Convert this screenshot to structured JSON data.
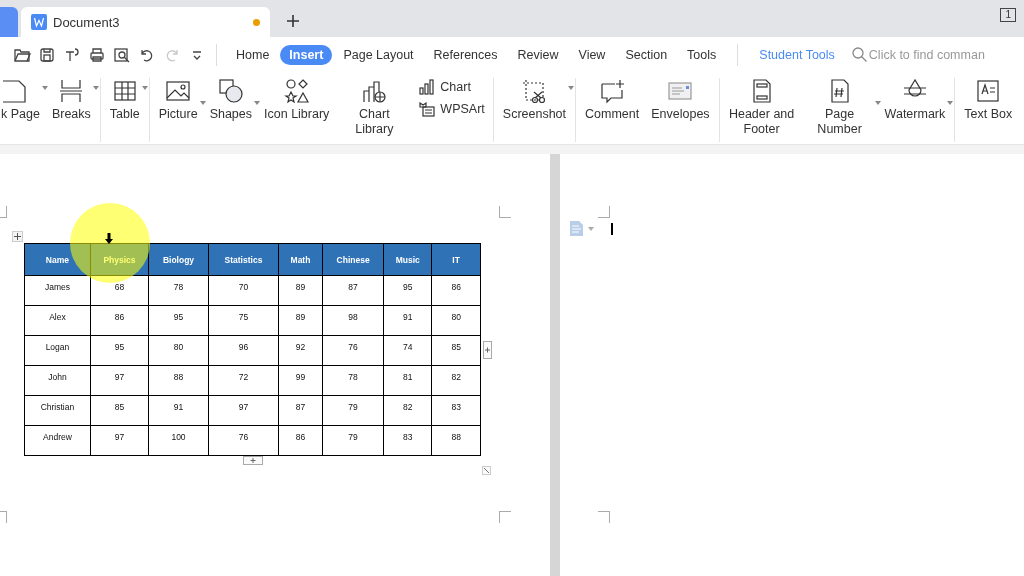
{
  "tab_bar": {
    "document": {
      "title": "Document3",
      "modified": true
    },
    "window_count": "1"
  },
  "quick_access": [
    {
      "disabled": false
    },
    {
      "disabled": false
    },
    {
      "disabled": false
    },
    {
      "disabled": false
    },
    {
      "disabled": false
    },
    {
      "disabled": false
    },
    {
      "disabled": true
    },
    {
      "disabled": false
    }
  ],
  "menu_tabs": [
    {
      "label": "Home",
      "selected": false
    },
    {
      "label": "Insert",
      "selected": true
    },
    {
      "label": "Page Layout",
      "selected": false
    },
    {
      "label": "References",
      "selected": false
    },
    {
      "label": "Review",
      "selected": false
    },
    {
      "label": "View",
      "selected": false
    },
    {
      "label": "Section",
      "selected": false
    },
    {
      "label": "Tools",
      "selected": false
    }
  ],
  "student_tools": "Student Tools",
  "search": {
    "placeholder": "Click to find comman"
  },
  "ribbon": {
    "groups": [
      {
        "items": [
          {
            "kind": "large",
            "label": "k Page",
            "dropdown": true
          },
          {
            "kind": "large",
            "label": "Breaks",
            "dropdown": true
          }
        ]
      },
      {
        "items": [
          {
            "kind": "large",
            "label": "Table",
            "dropdown": true
          }
        ]
      },
      {
        "items": [
          {
            "kind": "large",
            "label": "Picture",
            "dropdown": true
          },
          {
            "kind": "large",
            "label": "Shapes",
            "dropdown": true
          },
          {
            "kind": "large",
            "label": "Icon Library",
            "dropdown": false
          },
          {
            "kind": "large",
            "label": "Chart Library",
            "dropdown": false
          },
          {
            "kind": "small",
            "label": "Chart",
            "dropdown": false
          },
          {
            "kind": "small",
            "label": "WPSArt",
            "dropdown": false
          }
        ]
      },
      {
        "items": [
          {
            "kind": "large",
            "label": "Screenshot",
            "dropdown": true
          }
        ]
      },
      {
        "items": [
          {
            "kind": "large",
            "label": "Comment",
            "dropdown": false
          },
          {
            "kind": "large",
            "label": "Envelopes",
            "dropdown": false
          }
        ]
      },
      {
        "items": [
          {
            "kind": "large",
            "label": "Header and Footer",
            "dropdown": false
          },
          {
            "kind": "large",
            "label": "Page Number",
            "dropdown": true
          },
          {
            "kind": "large",
            "label": "Watermark",
            "dropdown": true
          }
        ]
      },
      {
        "items": [
          {
            "kind": "large",
            "label": "Text Box",
            "dropdown": false
          }
        ]
      }
    ]
  },
  "table": {
    "columns": [
      "Name",
      "Physics",
      "Biology",
      "Statistics",
      "Math",
      "Chinese",
      "Music",
      "IT"
    ],
    "rows": [
      [
        "James",
        "68",
        "78",
        "70",
        "89",
        "87",
        "95",
        "86"
      ],
      [
        "Alex",
        "86",
        "95",
        "75",
        "89",
        "98",
        "91",
        "80"
      ],
      [
        "Logan",
        "95",
        "80",
        "96",
        "92",
        "76",
        "74",
        "85"
      ],
      [
        "John",
        "97",
        "88",
        "72",
        "99",
        "78",
        "81",
        "82"
      ],
      [
        "Christian",
        "85",
        "91",
        "97",
        "87",
        "79",
        "82",
        "83"
      ],
      [
        "Andrew",
        "97",
        "100",
        "76",
        "86",
        "79",
        "83",
        "88"
      ]
    ]
  }
}
